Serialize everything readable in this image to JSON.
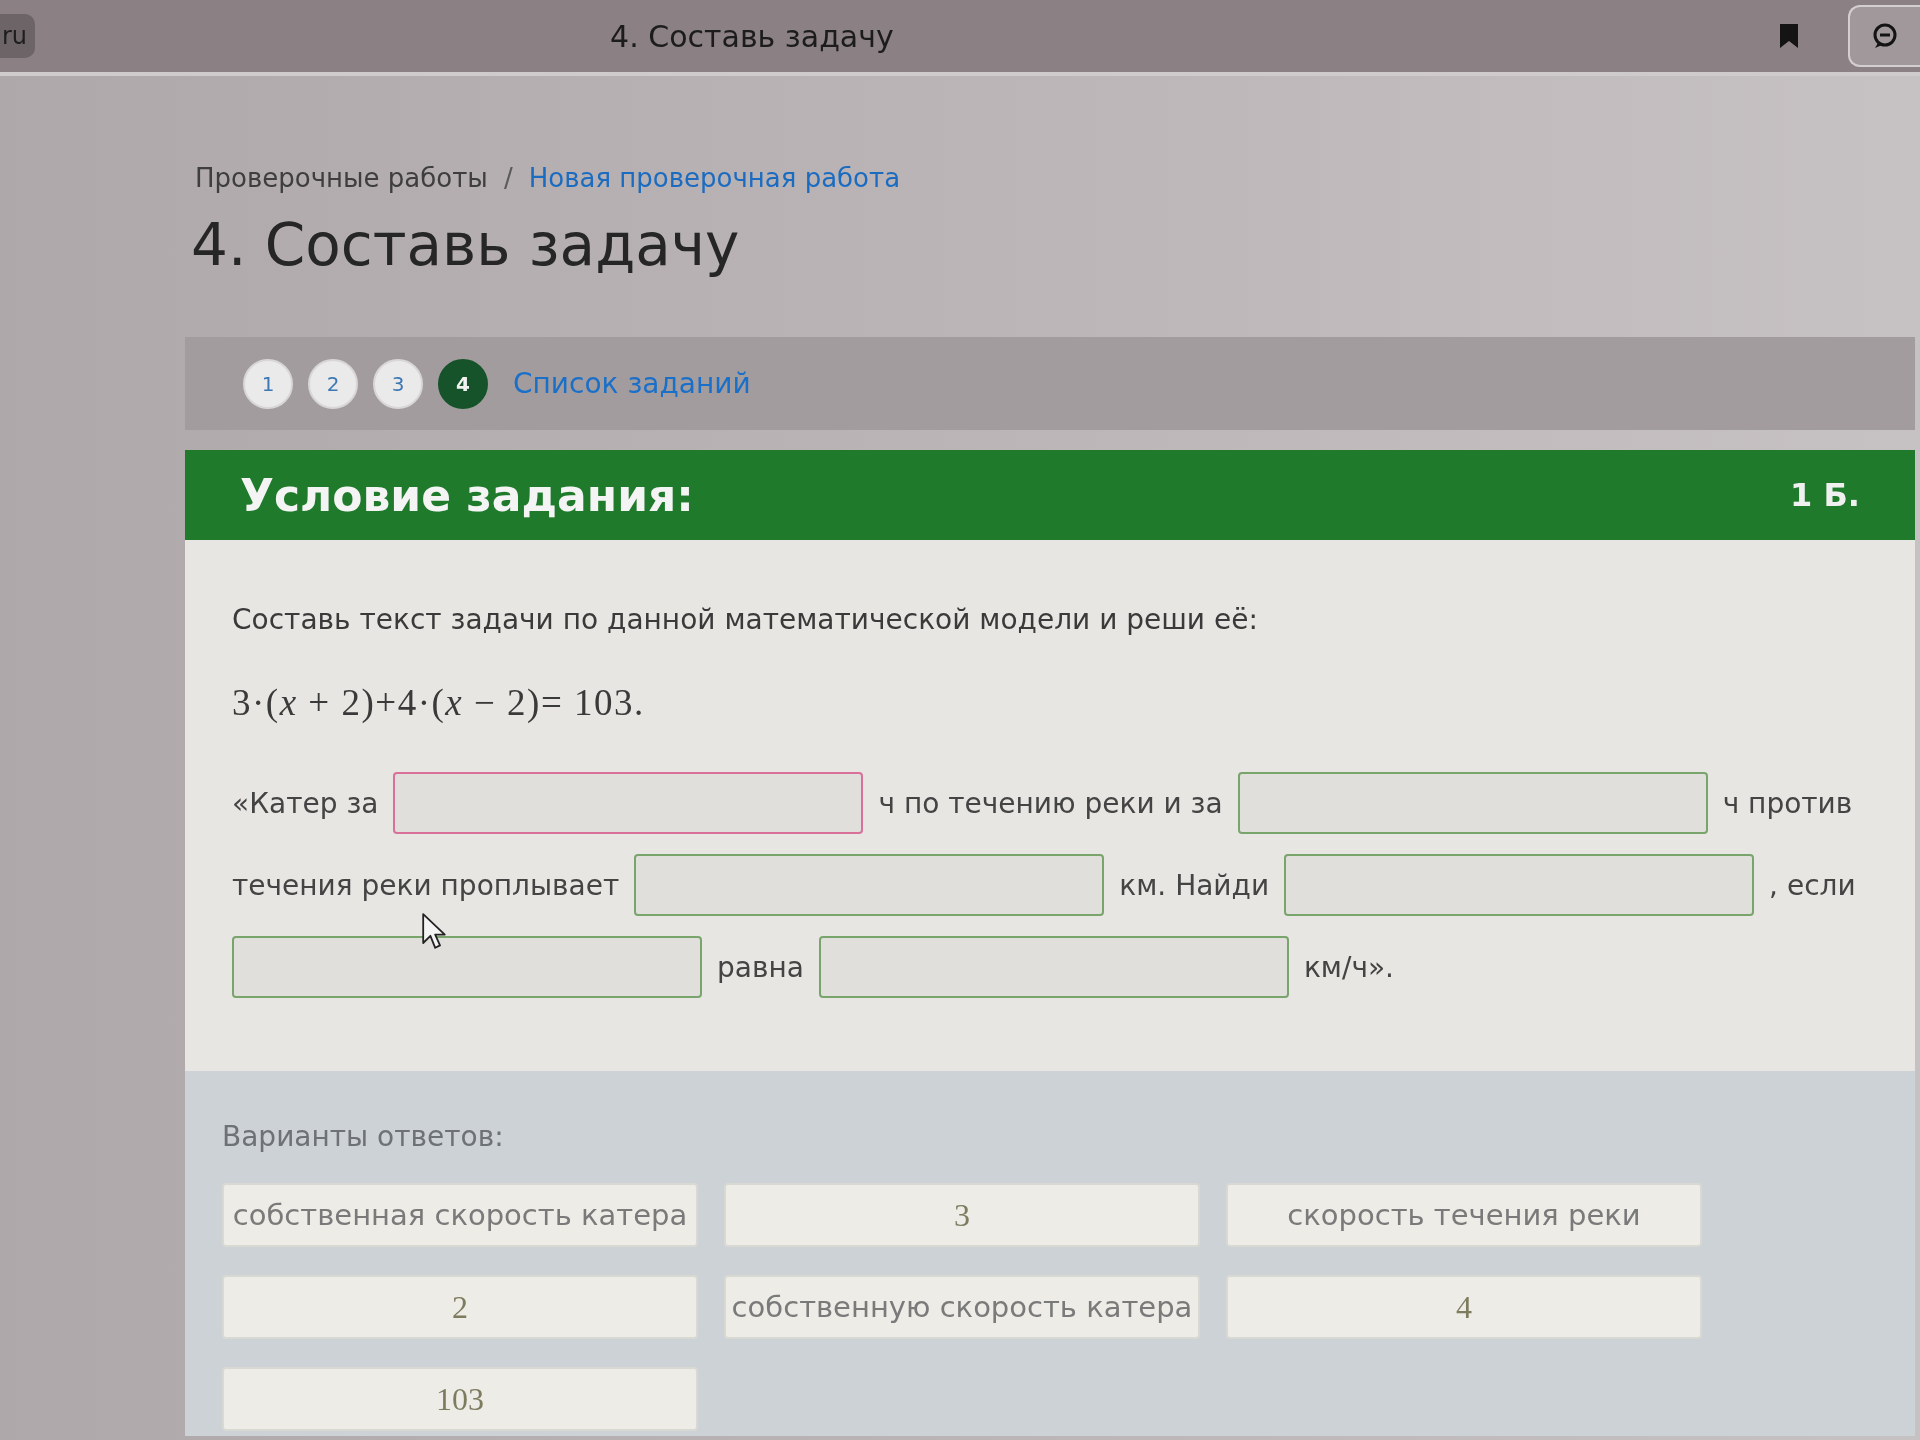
{
  "browser_bar": {
    "address": "ru",
    "title": "4. Составь задачу"
  },
  "breadcrumb": {
    "separator": "/",
    "items": [
      {
        "label": "Проверочные работы",
        "kind": "muted"
      },
      {
        "label": "Новая проверочная работа",
        "kind": "link"
      }
    ]
  },
  "page_title": "4. Составь задачу",
  "steps": {
    "items": [
      {
        "label": "1",
        "selected": false
      },
      {
        "label": "2",
        "selected": false
      },
      {
        "label": "3",
        "selected": false
      },
      {
        "label": "4",
        "selected": true
      }
    ],
    "task_list_link": "Список заданий"
  },
  "task": {
    "header": "Условие задания:",
    "points": "1 Б.",
    "instruction": "Составь текст задачи по данной математической модели и реши её:",
    "equation": "3·(*x* + 2)+4·(*x* − 2)= 103.",
    "lines": [
      [
        {
          "kind": "text",
          "text": "«Катер за"
        },
        {
          "kind": "blank",
          "focused": true
        },
        {
          "kind": "text",
          "text": "ч по течению реки и за"
        },
        {
          "kind": "blank",
          "focused": false
        },
        {
          "kind": "text",
          "text": "ч против"
        }
      ],
      [
        {
          "kind": "text",
          "text": "течения реки проплывает"
        },
        {
          "kind": "blank",
          "focused": false
        },
        {
          "kind": "text",
          "text": "км. Найди"
        },
        {
          "kind": "blank",
          "focused": false
        },
        {
          "kind": "text",
          "text": ", если"
        }
      ],
      [
        {
          "kind": "blank",
          "focused": false
        },
        {
          "kind": "text",
          "text": "равна"
        },
        {
          "kind": "blank",
          "focused": false
        },
        {
          "kind": "text",
          "text": "км/ч»."
        }
      ]
    ]
  },
  "answers": {
    "title": "Варианты ответов:",
    "options": [
      {
        "text": "собственная скорость катера",
        "kind": "text"
      },
      {
        "text": "3",
        "kind": "math"
      },
      {
        "text": "скорость течения реки",
        "kind": "text"
      },
      {
        "text": "2",
        "kind": "math"
      },
      {
        "text": "собственную скорость катера",
        "kind": "text"
      },
      {
        "text": "4",
        "kind": "math"
      },
      {
        "text": "103",
        "kind": "math"
      }
    ]
  }
}
